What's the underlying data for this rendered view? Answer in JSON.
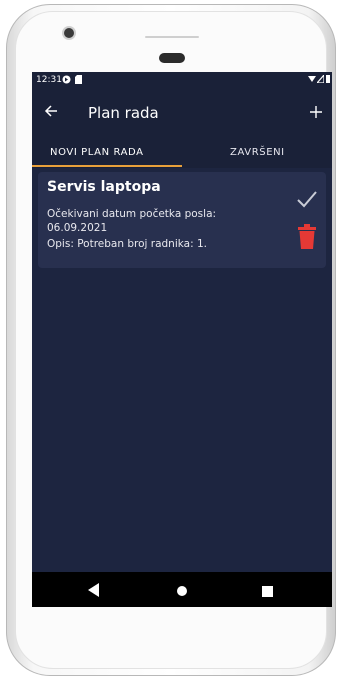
{
  "status_bar": {
    "time": "12:31"
  },
  "toolbar": {
    "back_icon": "arrow-left-icon",
    "title": "Plan rada",
    "add_icon": "plus-icon"
  },
  "tabs": [
    {
      "label": "NOVI PLAN RADA",
      "active": true
    },
    {
      "label": "ZAVRŠENI",
      "active": false
    }
  ],
  "card": {
    "title": "Servis laptopa",
    "line1": "Očekivani datum početka posla:",
    "line2": "06.09.2021",
    "line3": "Opis: Potreban broj radnika: 1."
  },
  "colors": {
    "background": "#1d2540",
    "card": "#28304f",
    "tab_indicator": "#e8a03a",
    "delete": "#e53935",
    "check": "#c9ccd6"
  },
  "nav_icons": [
    "back-triangle-icon",
    "home-circle-icon",
    "recents-square-icon"
  ]
}
